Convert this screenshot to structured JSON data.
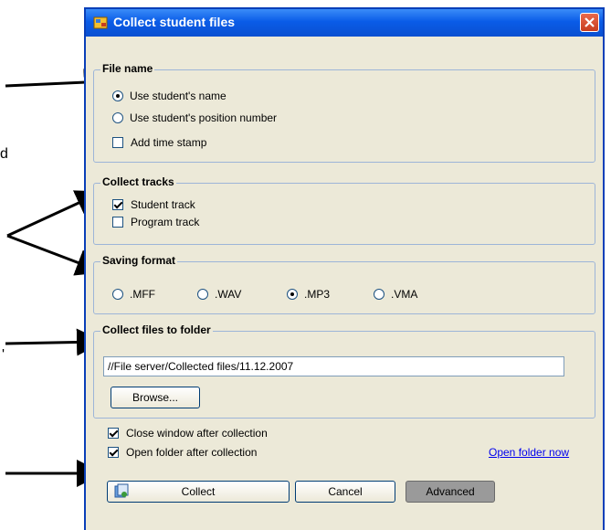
{
  "window": {
    "title": "Collect student files",
    "app_icon": "app-icon",
    "close_icon": "close-icon"
  },
  "stray_text": [
    "d",
    "'"
  ],
  "file_name": {
    "legend": "File name",
    "option_name": "Use student's name",
    "option_position": "Use student's position number",
    "selected": "Use student's name",
    "timestamp_label": "Add time stamp",
    "timestamp_checked": false
  },
  "collect_tracks": {
    "legend": "Collect tracks",
    "student_label": "Student track",
    "student_checked": true,
    "program_label": "Program track",
    "program_checked": false
  },
  "saving_format": {
    "legend": "Saving format",
    "formats": [
      ".MFF",
      ".WAV",
      ".MP3",
      ".VMA"
    ],
    "selected": ".MP3"
  },
  "folder": {
    "legend": "Collect files to folder",
    "path": "//File server/Collected files/11.12.2007",
    "browse_label": "Browse..."
  },
  "options": {
    "close_label": "Close window after collection",
    "close_checked": true,
    "open_label": "Open folder after collection",
    "open_checked": true,
    "open_now_link": "Open folder now"
  },
  "buttons": {
    "collect_label": "Collect",
    "collect_icon": "collect-icon",
    "cancel_label": "Cancel",
    "advanced_label": "Advanced"
  },
  "colors": {
    "titlebar": "#0a5ce8",
    "window_bg": "#ece9d8",
    "group_border": "#9db5d8",
    "link": "#0000ee"
  }
}
